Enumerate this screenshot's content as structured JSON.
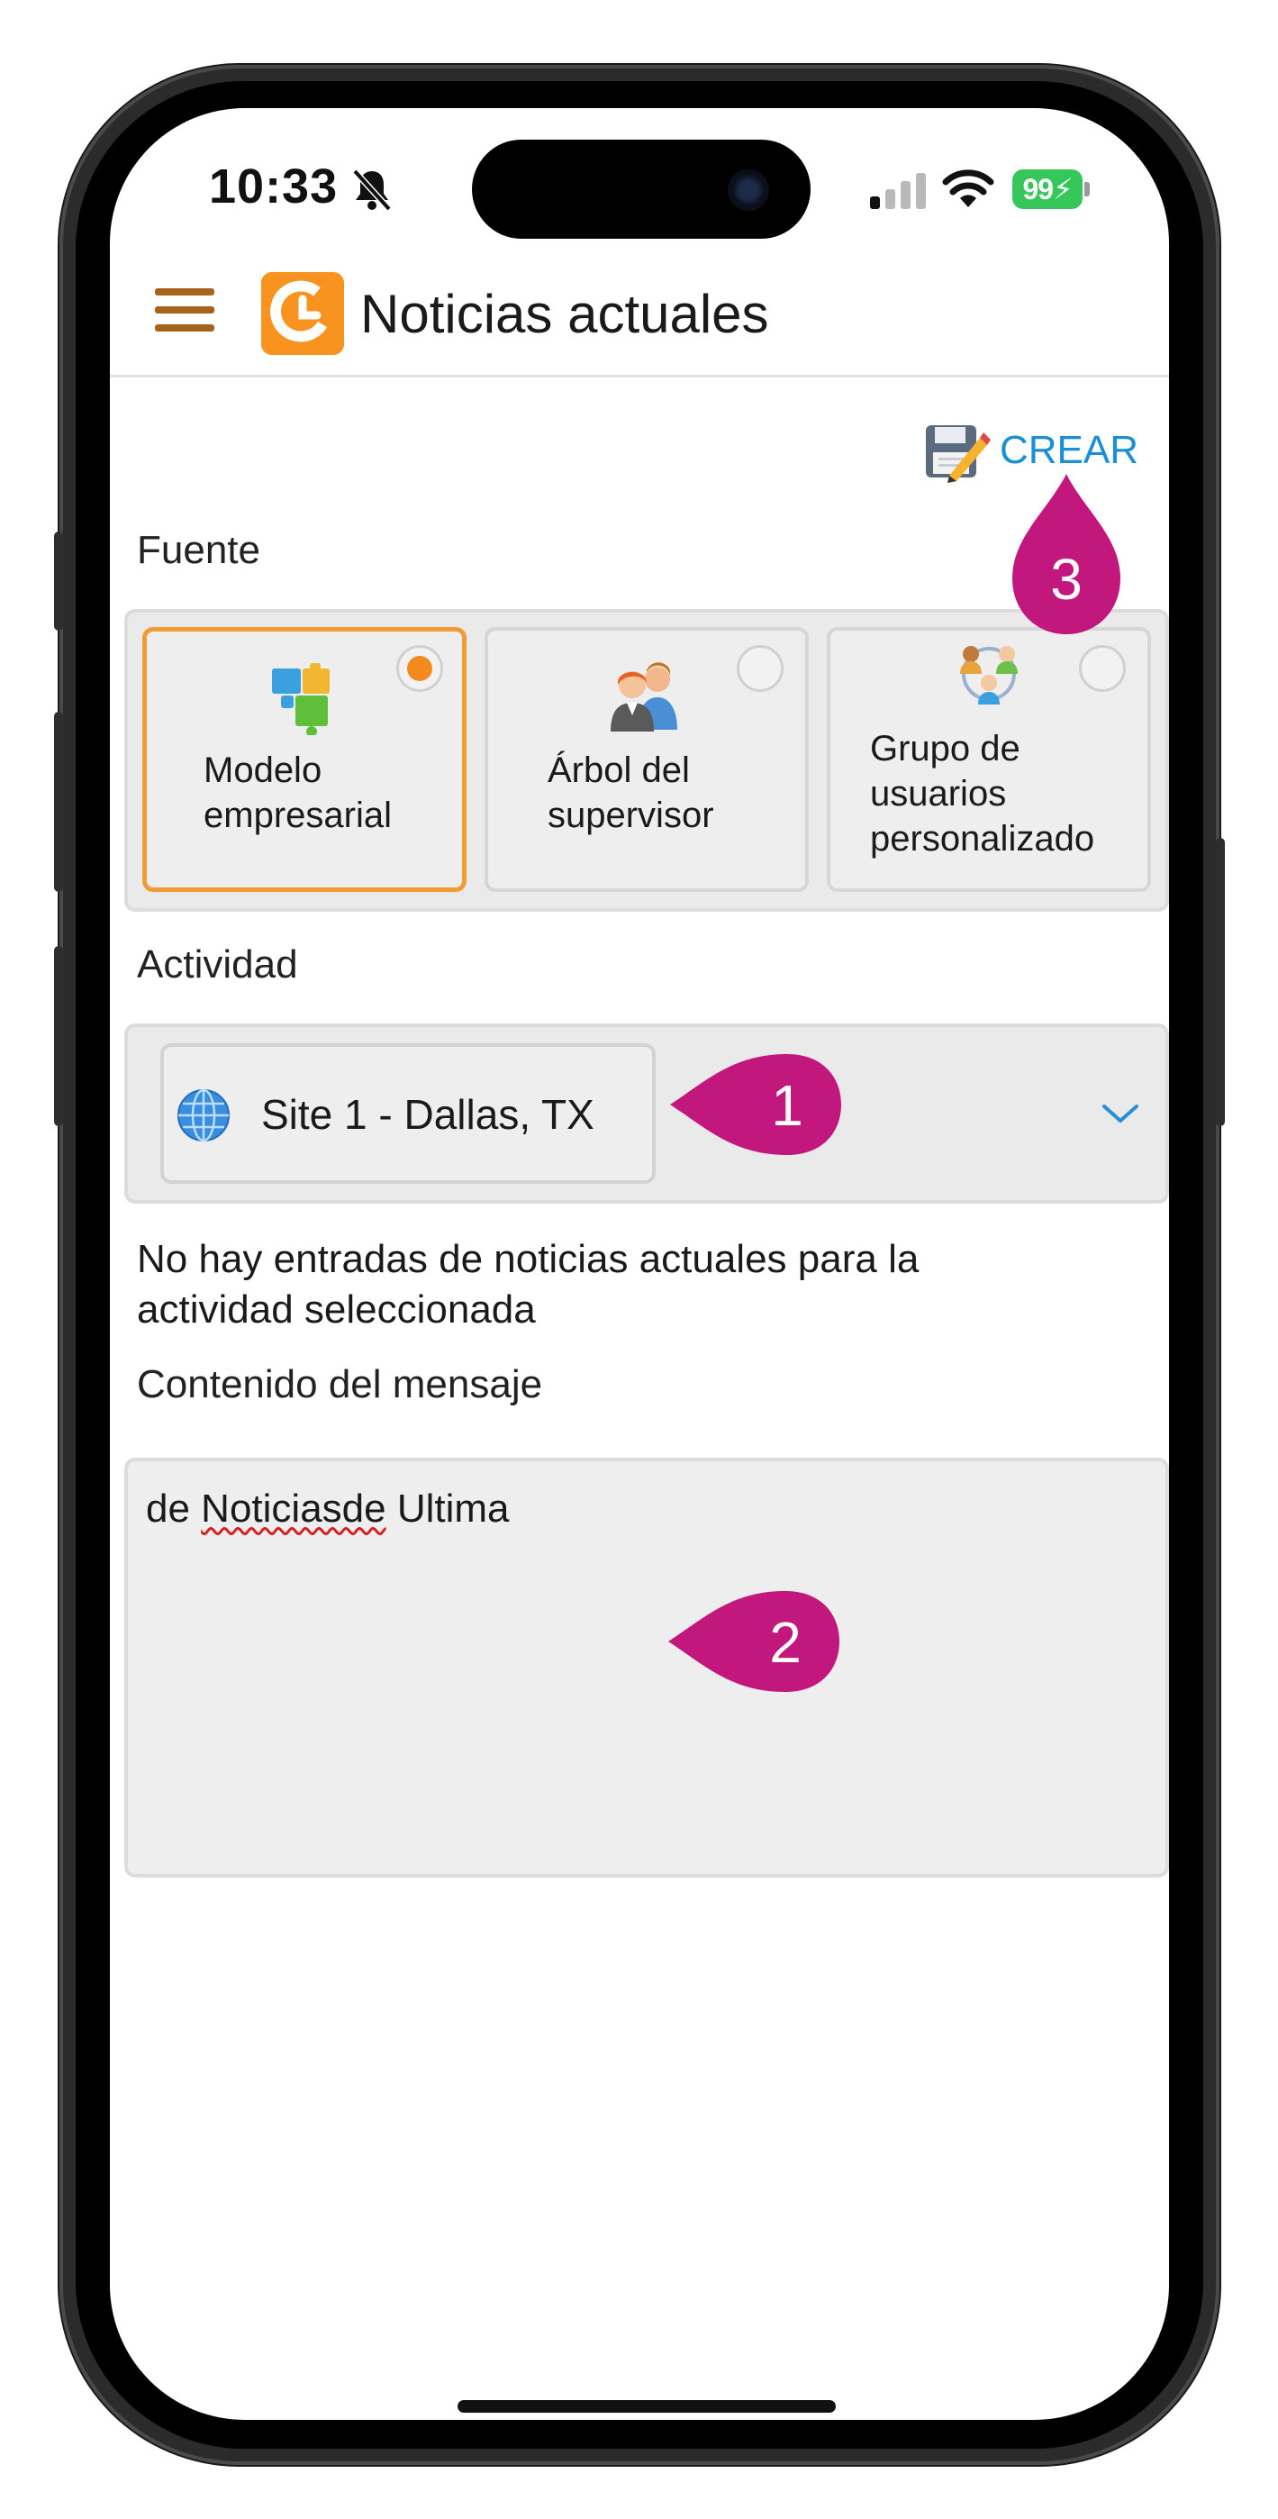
{
  "status_bar": {
    "time": "10:33",
    "battery": "99"
  },
  "header": {
    "title": "Noticias actuales",
    "menu_icon": "hamburger-menu-icon",
    "logo_icon": "app-logo-icon"
  },
  "toolbar": {
    "create_label": "CREAR"
  },
  "source": {
    "label": "Fuente",
    "options": [
      {
        "line1": "Modelo",
        "line2": "empresarial",
        "line3": "",
        "selected": true,
        "icon": "puzzle-icon"
      },
      {
        "line1": "Árbol del",
        "line2": "supervisor",
        "line3": "",
        "selected": false,
        "icon": "supervisor-icon"
      },
      {
        "line1": "Grupo de",
        "line2": "usuarios",
        "line3": "personalizado",
        "selected": false,
        "icon": "user-group-icon"
      }
    ]
  },
  "activity": {
    "label": "Actividad",
    "selected": "Site 1 - Dallas, TX",
    "empty_message": "No hay entradas de noticias actuales para la actividad seleccionada"
  },
  "message": {
    "label": "Contenido del mensaje",
    "prefix": "de ",
    "misspelled": "Noticiasde",
    "suffix": " Ultima"
  },
  "callouts": {
    "one": "1",
    "two": "2",
    "three": "3"
  },
  "colors": {
    "accent_orange": "#f7931e",
    "link_blue": "#1a8fd6",
    "callout_magenta": "#c2177d",
    "battery_green": "#35c759"
  }
}
